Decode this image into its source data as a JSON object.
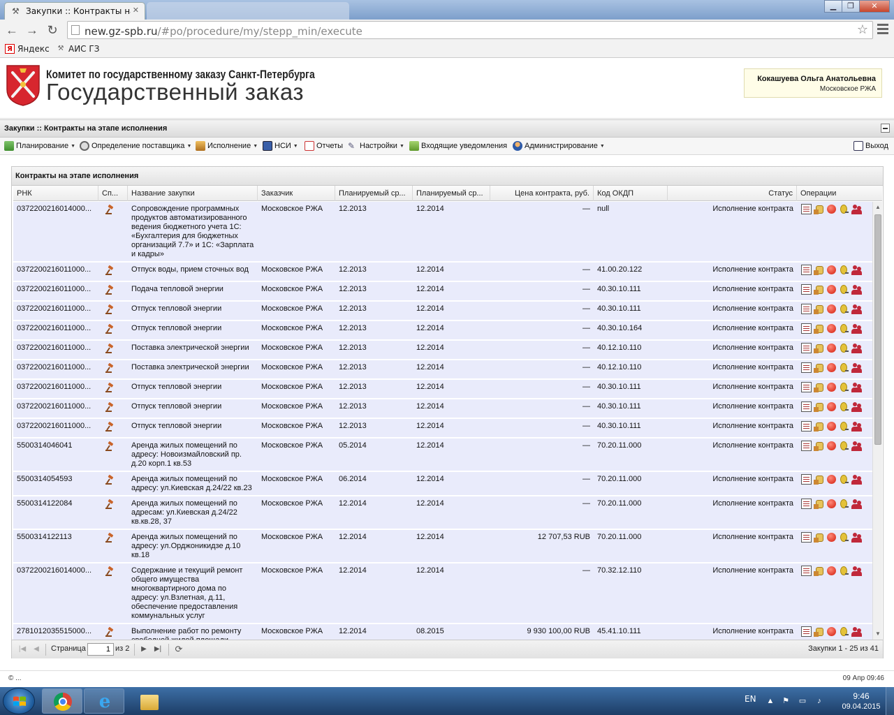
{
  "browser": {
    "active_tab_title": "Закупки :: Контракты на э",
    "inactive_tab_title": "...",
    "url_host": "new.gz-spb.ru",
    "url_path": "/#po/procedure/my/stepp_min/execute",
    "bookmarks": [
      {
        "label": "Яндекс",
        "icon": "yandex-icon"
      },
      {
        "label": "АИС ГЗ",
        "icon": "tools-icon"
      }
    ]
  },
  "header": {
    "org_line1": "Комитет по государственному заказу Санкт-Петербурга",
    "org_line2": "Государственный заказ",
    "user_name": "Кокашуева Ольга Анатольевна",
    "user_org": "Московское РЖА"
  },
  "section": {
    "title": "Закупки :: Контракты на этапе исполнения"
  },
  "menu": {
    "items": [
      {
        "label": "Планирование",
        "has_menu": true
      },
      {
        "label": "Определение поставщика",
        "has_menu": true
      },
      {
        "label": "Исполнение",
        "has_menu": true
      },
      {
        "label": "НСИ",
        "has_menu": true
      },
      {
        "label": "Отчеты",
        "has_menu": false
      },
      {
        "label": "Настройки",
        "has_menu": true
      },
      {
        "label": "Входящие уведомления",
        "has_menu": false
      },
      {
        "label": "Администрирование",
        "has_menu": true
      }
    ],
    "exit_label": "Выход"
  },
  "grid": {
    "title": "Контракты на этапе исполнения",
    "columns": [
      "РНК",
      "Сп...",
      "Название закупки",
      "Заказчик",
      "Планируемый ср...",
      "Планируемый ср...",
      "Цена контракта, руб.",
      "Код ОКДП",
      "Статус",
      "Операции"
    ],
    "rows": [
      {
        "rnk": "0372200216014000...",
        "name": "Сопровождение программных продуктов автоматизированного ведения бюджетного учета 1С: «Бухгалтерия для бюджетных организаций 7.7» и 1С: «Зарплата и кадры»",
        "customer": "Московское РЖА",
        "start": "12.2013",
        "end": "12.2014",
        "price": "—",
        "okdp": "null",
        "status": "Исполнение контракта",
        "lines": 6
      },
      {
        "rnk": "0372200216011000...",
        "name": "Отпуск воды, прием сточных вод",
        "customer": "Московское РЖА",
        "start": "12.2013",
        "end": "12.2014",
        "price": "—",
        "okdp": "41.00.20.122",
        "status": "Исполнение контракта",
        "lines": 1
      },
      {
        "rnk": "0372200216011000...",
        "name": "Подача тепловой энергии",
        "customer": "Московское РЖА",
        "start": "12.2013",
        "end": "12.2014",
        "price": "—",
        "okdp": "40.30.10.111",
        "status": "Исполнение контракта",
        "lines": 1
      },
      {
        "rnk": "0372200216011000...",
        "name": "Отпуск тепловой энергии",
        "customer": "Московское РЖА",
        "start": "12.2013",
        "end": "12.2014",
        "price": "—",
        "okdp": "40.30.10.111",
        "status": "Исполнение контракта",
        "lines": 1
      },
      {
        "rnk": "0372200216011000...",
        "name": "Отпуск тепловой энергии",
        "customer": "Московское РЖА",
        "start": "12.2013",
        "end": "12.2014",
        "price": "—",
        "okdp": "40.30.10.164",
        "status": "Исполнение контракта",
        "lines": 1
      },
      {
        "rnk": "0372200216011000...",
        "name": "Поставка электрической энергии",
        "customer": "Московское РЖА",
        "start": "12.2013",
        "end": "12.2014",
        "price": "—",
        "okdp": "40.12.10.110",
        "status": "Исполнение контракта",
        "lines": 1
      },
      {
        "rnk": "0372200216011000...",
        "name": "Поставка электрической энергии",
        "customer": "Московское РЖА",
        "start": "12.2013",
        "end": "12.2014",
        "price": "—",
        "okdp": "40.12.10.110",
        "status": "Исполнение контракта",
        "lines": 1
      },
      {
        "rnk": "0372200216011000...",
        "name": "Отпуск тепловой энергии",
        "customer": "Московское РЖА",
        "start": "12.2013",
        "end": "12.2014",
        "price": "—",
        "okdp": "40.30.10.111",
        "status": "Исполнение контракта",
        "lines": 1
      },
      {
        "rnk": "0372200216011000...",
        "name": "Отпуск тепловой энергии",
        "customer": "Московское РЖА",
        "start": "12.2013",
        "end": "12.2014",
        "price": "—",
        "okdp": "40.30.10.111",
        "status": "Исполнение контракта",
        "lines": 1
      },
      {
        "rnk": "0372200216011000...",
        "name": "Отпуск тепловой энергии",
        "customer": "Московское РЖА",
        "start": "12.2013",
        "end": "12.2014",
        "price": "—",
        "okdp": "40.30.10.111",
        "status": "Исполнение контракта",
        "lines": 1
      },
      {
        "rnk": "5500314046041",
        "name": "Аренда жилых помещений по адресу: Новоизмайловский пр. д.20 корп.1 кв.53",
        "customer": "Московское РЖА",
        "start": "05.2014",
        "end": "12.2014",
        "price": "—",
        "okdp": "70.20.11.000",
        "status": "Исполнение контракта",
        "lines": 3
      },
      {
        "rnk": "5500314054593",
        "name": "Аренда жилых помещений по адресу: ул.Киевская д.24/22 кв.23",
        "customer": "Московское РЖА",
        "start": "06.2014",
        "end": "12.2014",
        "price": "—",
        "okdp": "70.20.11.000",
        "status": "Исполнение контракта",
        "lines": 2
      },
      {
        "rnk": "5500314122084",
        "name": "Аренда жилых помещений по адресам: ул.Киевская д.24/22 кв.кв.28, 37",
        "customer": "Московское РЖА",
        "start": "12.2014",
        "end": "12.2014",
        "price": "—",
        "okdp": "70.20.11.000",
        "status": "Исполнение контракта",
        "lines": 3
      },
      {
        "rnk": "5500314122113",
        "name": "Аренда жилых помещений по адресу: ул.Орджоникидзе д.10 кв.18",
        "customer": "Московское РЖА",
        "start": "12.2014",
        "end": "12.2014",
        "price": "12 707,53 RUB",
        "okdp": "70.20.11.000",
        "status": "Исполнение контракта",
        "lines": 3
      },
      {
        "rnk": "0372200216014000...",
        "name": "Содержание и текущий ремонт общего имущества многоквартирного дома по адресу: ул.Взлетная, д.11, обеспечение предоставления коммунальных услуг",
        "customer": "Московское РЖА",
        "start": "12.2014",
        "end": "12.2014",
        "price": "—",
        "okdp": "70.32.12.110",
        "status": "Исполнение контракта",
        "lines": 6
      },
      {
        "rnk": "2781012035515000...",
        "name": "Выполнение работ по ремонту свободной жилой площади, находящейся в собственности",
        "customer": "Московское РЖА",
        "start": "12.2014",
        "end": "08.2015",
        "price": "9 930 100,00 RUB",
        "okdp": "45.41.10.111",
        "status": "Исполнение контракта",
        "lines": 3
      }
    ]
  },
  "pager": {
    "page_label": "Страница",
    "page_value": "1",
    "of_label": "из 2",
    "summary": "Закупки 1 - 25 из 41"
  },
  "footer": {
    "left": "© ...",
    "right": "09 Апр 09:46"
  },
  "taskbar": {
    "lang": "EN",
    "time": "9:46",
    "date": "09.04.2015"
  }
}
